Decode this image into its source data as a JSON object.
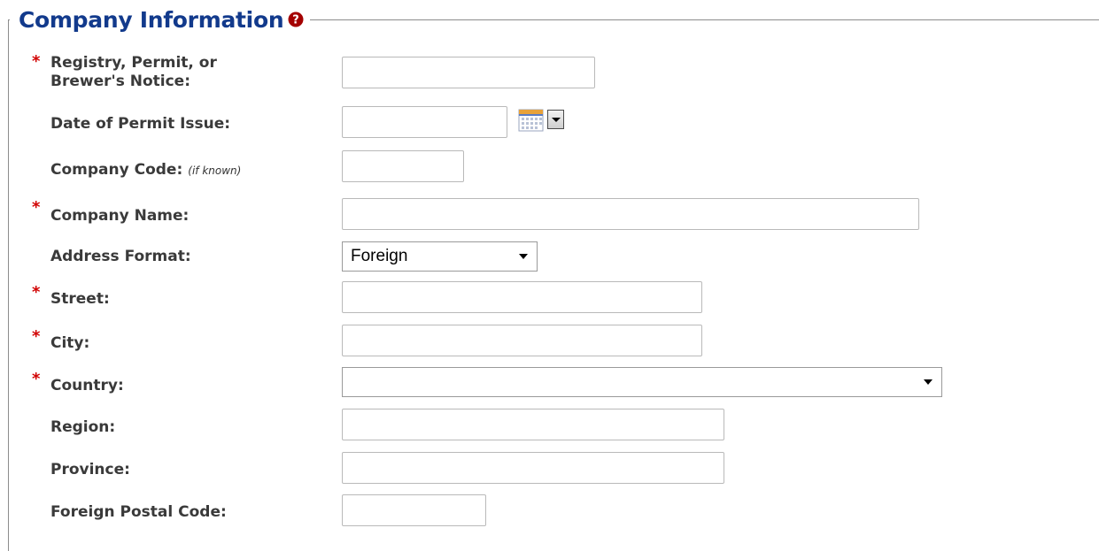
{
  "section": {
    "title": "Company Information",
    "help_icon": "question-circle-icon",
    "required_marker": "*"
  },
  "fields": {
    "registry": {
      "label_line1": "Registry, Permit, or",
      "label_line2": "Brewer's Notice:",
      "value": "",
      "required": true
    },
    "permit_date": {
      "label": "Date of Permit Issue:",
      "value": "",
      "calendar_icon": "calendar-icon",
      "dropdown_icon": "chevron-down-icon"
    },
    "company_code": {
      "label": "Company Code:",
      "note": "(if known)",
      "value": ""
    },
    "company_name": {
      "label": "Company Name:",
      "value": "",
      "required": true
    },
    "address_format": {
      "label": "Address Format:",
      "selected": "Foreign"
    },
    "street": {
      "label": "Street:",
      "value": "",
      "required": true
    },
    "city": {
      "label": "City:",
      "value": "",
      "required": true
    },
    "country": {
      "label": "Country:",
      "selected": "",
      "required": true
    },
    "region": {
      "label": "Region:",
      "value": ""
    },
    "province": {
      "label": "Province:",
      "value": ""
    },
    "postal_code": {
      "label": "Foreign Postal Code:",
      "value": ""
    }
  },
  "colors": {
    "title": "#123a8c",
    "required": "#d10000",
    "label": "#3a3a3a",
    "help_icon": "#a40000"
  }
}
